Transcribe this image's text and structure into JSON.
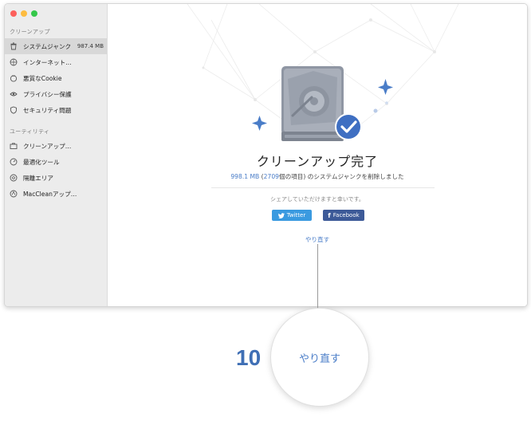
{
  "sidebar": {
    "section_cleanup": "クリーンアップ",
    "section_utility": "ユーティリティ",
    "items": [
      {
        "label": "システムジャンク",
        "size": "987.4 MB",
        "icon": "trash-icon"
      },
      {
        "label": "インターネット…",
        "icon": "globe-icon"
      },
      {
        "label": "悪質なCookie",
        "icon": "cookie-icon"
      },
      {
        "label": "プライバシー保護",
        "icon": "eye-icon"
      },
      {
        "label": "セキュリティ問題",
        "icon": "shield-icon"
      },
      {
        "label": "クリーンアップ…",
        "icon": "briefcase-icon"
      },
      {
        "label": "最適化ツール",
        "icon": "gauge-icon"
      },
      {
        "label": "隔離エリア",
        "icon": "quarantine-icon"
      },
      {
        "label": "MacCleanアップ…",
        "icon": "app-icon"
      }
    ]
  },
  "main": {
    "title": "クリーンアップ完了",
    "summary_size": "998.1 MB",
    "summary_open": " (",
    "summary_count": "2709",
    "summary_rest": "個の項目) のシステムジャンクを削除しました",
    "share_text": "シェアしていただけますと幸いです。",
    "twitter_label": "Twitter",
    "facebook_label": "Facebook",
    "redo_label": "やり直す"
  },
  "callout": {
    "step": "10",
    "label": "やり直す"
  },
  "colors": {
    "accent_blue": "#4a7dc8",
    "twitter": "#3a9ae0",
    "facebook": "#3d5a98",
    "close": "#fc605c",
    "minimize": "#fdbc40",
    "zoom": "#34c84a"
  }
}
